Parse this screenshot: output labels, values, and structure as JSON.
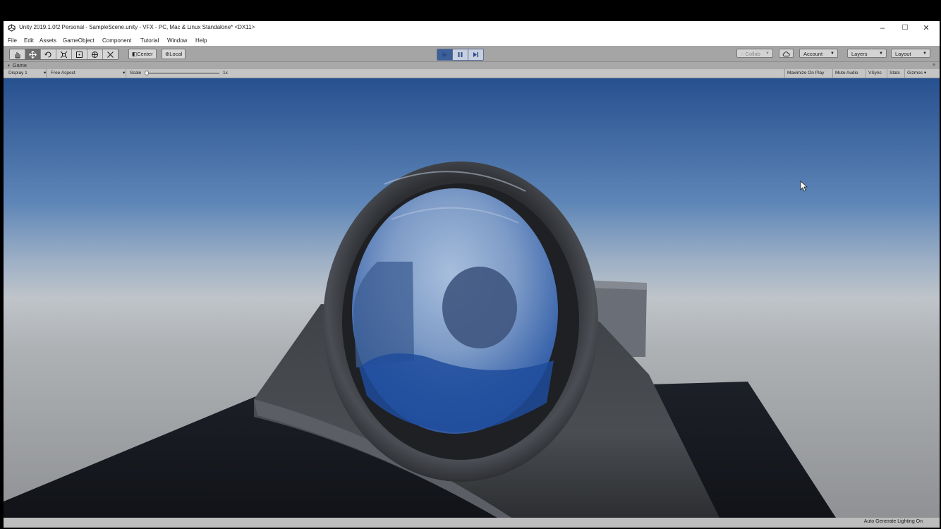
{
  "window": {
    "title": "Unity 2019.1.0f2 Personal - SampleScene.unity - VFX - PC, Mac & Linux Standalone* <DX11>",
    "controls": {
      "minimize": "–",
      "maximize": "☐",
      "close": "✕"
    }
  },
  "menubar": {
    "items": [
      "File",
      "Edit",
      "Assets",
      "GameObject",
      "Component",
      "Tutorial",
      "Window",
      "Help"
    ]
  },
  "toolbar": {
    "tools": [
      "hand-icon",
      "move-icon",
      "rotate-icon",
      "scale-icon",
      "rect-tool-icon",
      "transform-icon",
      "custom-tool-icon"
    ],
    "active_tool": "move-icon",
    "pivot_label": "Center",
    "space_label": "Local",
    "play_controls": [
      "play-icon",
      "pause-icon",
      "step-icon"
    ],
    "collab_label": "Collab",
    "account_label": "Account",
    "layers_label": "Layers",
    "layout_label": "Layout"
  },
  "tabs": {
    "game_label": "Game"
  },
  "game_toolbar": {
    "display": "Display 1",
    "aspect": "Free Aspect",
    "scale_label": "Scale",
    "scale_value": "1x",
    "maximize_on_play": "Maximize On Play",
    "mute_audio": "Mute Audio",
    "vsync": "VSync",
    "stats": "Stats",
    "gizmos": "Gizmos"
  },
  "statusbar": {
    "text": "Auto Generate Lighting On"
  },
  "colors": {
    "play_accent": "#3c5f9a",
    "sky_top": "#27508f",
    "horizon": "#b7bcc2",
    "glass_blue": "#2f5aa5"
  }
}
